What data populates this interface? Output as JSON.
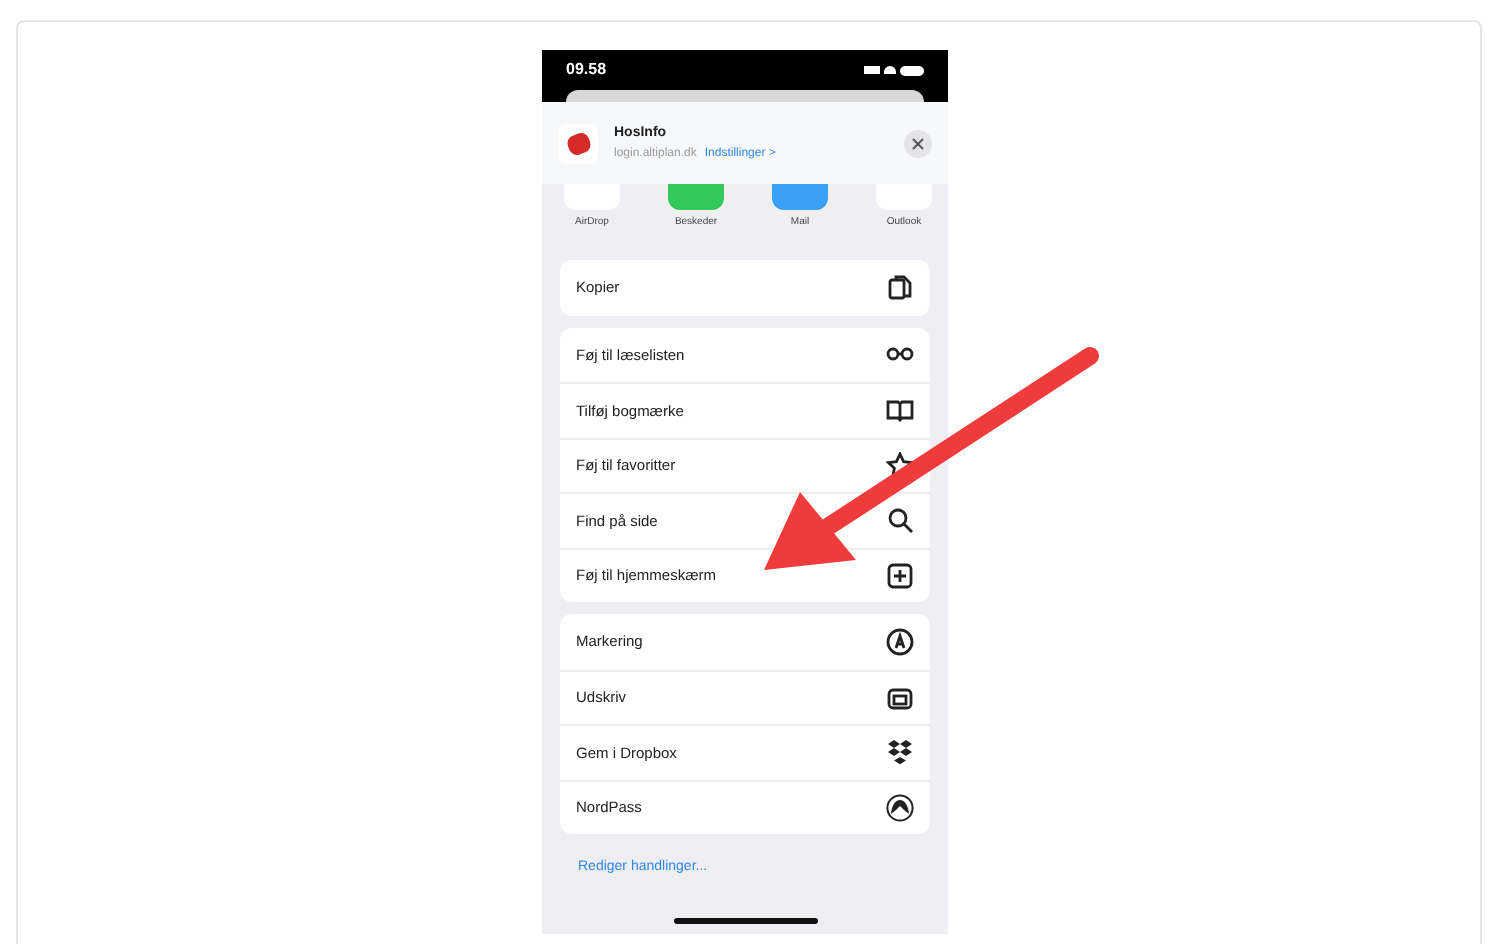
{
  "status_bar": {
    "time": "09.58"
  },
  "share_header": {
    "title": "HosInfo",
    "url": "login.altiplan.dk",
    "options_link": "Indstillinger >"
  },
  "apps": [
    {
      "label": "AirDrop"
    },
    {
      "label": "Beskeder"
    },
    {
      "label": "Mail"
    },
    {
      "label": "Outlook"
    }
  ],
  "action_groups": [
    {
      "items": [
        {
          "label": "Kopier"
        }
      ]
    },
    {
      "items": [
        {
          "label": "Føj til læselisten"
        },
        {
          "label": "Tilføj bogmærke"
        },
        {
          "label": "Føj til favoritter"
        },
        {
          "label": "Find på side"
        },
        {
          "label": "Føj til hjemmeskærm"
        }
      ]
    },
    {
      "items": [
        {
          "label": "Markering"
        },
        {
          "label": "Udskriv"
        },
        {
          "label": "Gem i Dropbox"
        },
        {
          "label": "NordPass"
        }
      ]
    }
  ],
  "edit_actions_link": "Rediger handlinger..."
}
